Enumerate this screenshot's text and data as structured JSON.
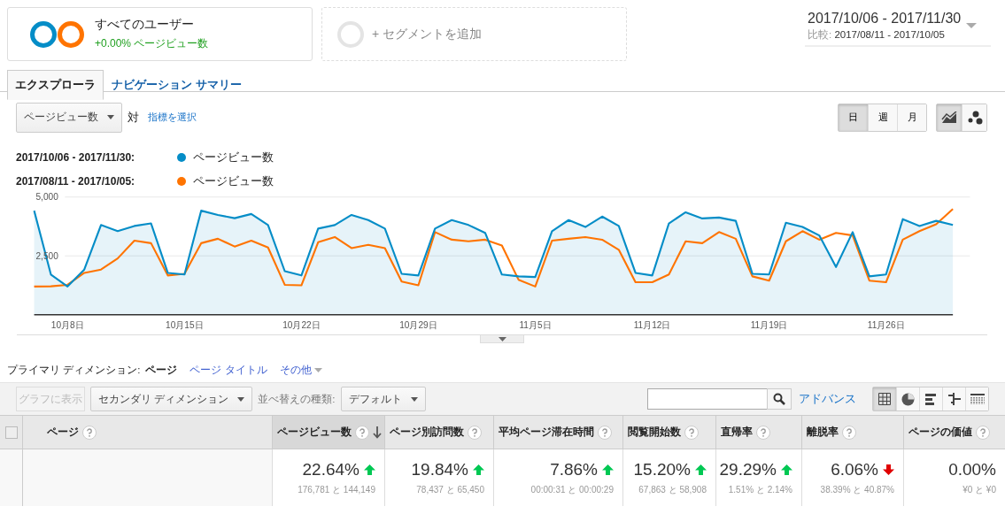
{
  "segments": [
    {
      "kind": "active",
      "title": "すべてのユーザー",
      "subtitle": "+0.00% ページビュー数"
    },
    {
      "kind": "add",
      "title": "+ セグメントを追加"
    }
  ],
  "date_range": {
    "main": "2017/10/06 - 2017/11/30",
    "compare_label": "比較:",
    "compare": "2017/08/11 - 2017/10/05"
  },
  "tabs": [
    {
      "label": "エクスプローラ",
      "selected": true
    },
    {
      "label": "ナビゲーション サマリー",
      "selected": false
    }
  ],
  "metric_dropdown": "ページビュー数",
  "versus": "対",
  "select_metric_link": "指標を選択",
  "period_buttons": [
    {
      "label": "日",
      "selected": true
    },
    {
      "label": "週",
      "selected": false
    },
    {
      "label": "月",
      "selected": false
    }
  ],
  "chart_type_buttons": [
    {
      "kind": "line",
      "selected": true
    },
    {
      "kind": "scatter",
      "selected": false
    }
  ],
  "chart": {
    "legend_periods": [
      "2017/10/06 - 2017/11/30:",
      "2017/08/11 - 2017/10/05:"
    ],
    "chart_data": {
      "type": "area",
      "categories": [
        null,
        null,
        "10月8日",
        null,
        null,
        null,
        null,
        null,
        null,
        "10月15日",
        null,
        null,
        null,
        null,
        null,
        null,
        "10月22日",
        null,
        null,
        null,
        null,
        null,
        null,
        "10月29日",
        null,
        null,
        null,
        null,
        null,
        null,
        "11月5日",
        null,
        null,
        null,
        null,
        null,
        null,
        "11月12日",
        null,
        null,
        null,
        null,
        null,
        null,
        "11月19日",
        null,
        null,
        null,
        null,
        null,
        null,
        "11月26日",
        null,
        null,
        null,
        null
      ],
      "series": [
        {
          "name": "ページビュー数",
          "type": "area",
          "color": "#058dc7",
          "values": [
            4420,
            1710,
            1200,
            1920,
            3810,
            3550,
            3770,
            3880,
            1780,
            1710,
            4420,
            4240,
            4100,
            4280,
            3810,
            1850,
            1670,
            3660,
            3810,
            4240,
            4020,
            3660,
            1740,
            1670,
            3660,
            4020,
            3810,
            3480,
            1710,
            1630,
            1600,
            3550,
            4020,
            3730,
            4170,
            3770,
            1780,
            1670,
            3880,
            4350,
            4090,
            4130,
            3990,
            1740,
            1710,
            3910,
            3730,
            3370,
            2030,
            3510,
            1630,
            1710,
            4060,
            3770,
            3990,
            3810
          ]
        },
        {
          "name": "ページビュー数",
          "type": "line",
          "color": "#ff7400",
          "values": [
            1200,
            1210,
            1270,
            1780,
            1920,
            2390,
            3150,
            3040,
            1670,
            1740,
            3040,
            3230,
            2900,
            3150,
            2860,
            1270,
            1250,
            3080,
            3300,
            2830,
            2970,
            2830,
            1410,
            1250,
            3510,
            3190,
            3120,
            3190,
            2940,
            1490,
            1200,
            3150,
            3230,
            3300,
            3190,
            2760,
            1380,
            1380,
            1710,
            3120,
            3040,
            3510,
            3230,
            1630,
            1450,
            3120,
            3550,
            3190,
            3480,
            3370,
            1450,
            1380,
            3190,
            3550,
            3840,
            4490
          ]
        }
      ],
      "ylim": [
        0,
        5000
      ],
      "yticks": [
        {
          "value": 2500,
          "label": "2,500"
        },
        {
          "value": 5000,
          "label": "5,000"
        }
      ]
    }
  },
  "primary_dimension": {
    "label": "プライマリ ディメンション:",
    "options": [
      {
        "label": "ページ",
        "selected": true,
        "dropdown": false
      },
      {
        "label": "ページ タイトル",
        "selected": false,
        "dropdown": false
      },
      {
        "label": "その他",
        "selected": false,
        "dropdown": true
      }
    ]
  },
  "table_toolbar": {
    "plot_button": "グラフに表示",
    "secondary_dimension": "セカンダリ ディメンション",
    "sort_label": "並べ替えの種類:",
    "sort_value": "デフォルト",
    "advanced_link": "アドバンス",
    "views": [
      {
        "kind": "table",
        "selected": true
      },
      {
        "kind": "pie",
        "selected": false
      },
      {
        "kind": "performance",
        "selected": false
      },
      {
        "kind": "comparison",
        "selected": false
      },
      {
        "kind": "pivot",
        "selected": false
      }
    ]
  },
  "table": {
    "select_all": {
      "checked": false
    },
    "columns": [
      {
        "label": "ページ",
        "sorted": false
      },
      {
        "label": "ページビュー数",
        "sorted": true
      },
      {
        "label": "ページ別訪問数",
        "sorted": false
      },
      {
        "label": "平均ページ滞在時間",
        "sorted": false
      },
      {
        "label": "閲覧開始数",
        "sorted": false
      },
      {
        "label": "直帰率",
        "sorted": false
      },
      {
        "label": "離脱率",
        "sorted": false
      },
      {
        "label": "ページの価値",
        "sorted": false
      }
    ],
    "summary": [
      {
        "change": "22.64%",
        "kind": "increase",
        "detail": "176,781 と 144,149"
      },
      {
        "change": "19.84%",
        "kind": "increase",
        "detail": "78,437 と 65,450"
      },
      {
        "change": "7.86%",
        "kind": "increase",
        "detail": "00:00:31 と 00:00:29"
      },
      {
        "change": "15.20%",
        "kind": "increase",
        "detail": "67,863 と 58,908"
      },
      {
        "change": "29.29%",
        "kind": "increase",
        "detail": "1.51% と 2.14%"
      },
      {
        "change": "6.06%",
        "kind": "decrease",
        "detail": "38.39% と 40.87%"
      },
      {
        "change": "0.00%",
        "kind": "flat",
        "detail": "¥0 と ¥0"
      }
    ]
  }
}
